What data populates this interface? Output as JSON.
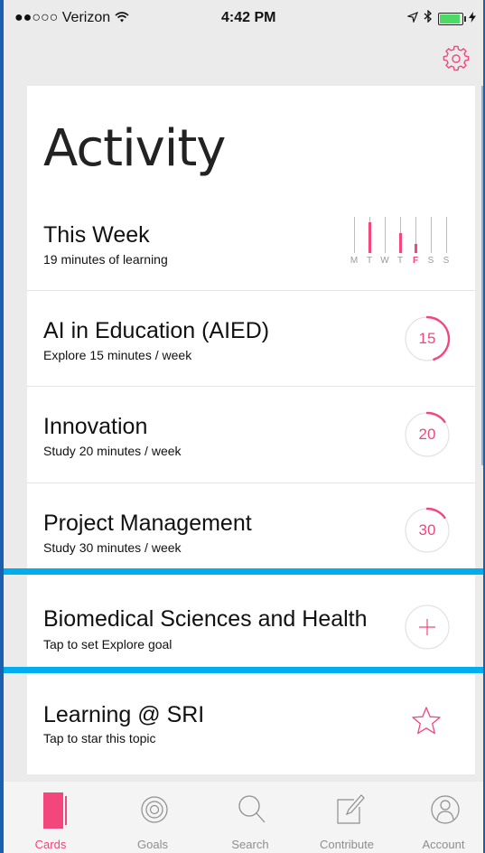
{
  "status_bar": {
    "carrier": "●●○○○ Verizon",
    "time": "4:42 PM"
  },
  "header": {
    "title": "Activity",
    "settings_icon": "gear-icon"
  },
  "this_week": {
    "title": "This Week",
    "subtitle": "19 minutes of learning",
    "days": [
      "M",
      "T",
      "W",
      "T",
      "F",
      "S",
      "S"
    ],
    "today_index": 4,
    "day_levels": [
      0,
      0.85,
      0,
      0.55,
      0.25,
      0,
      0
    ]
  },
  "topics": [
    {
      "title": "AI in Education (AIED)",
      "subtitle": "Explore 15 minutes / week",
      "goal": "15",
      "progress": 0.45
    },
    {
      "title": "Innovation",
      "subtitle": "Study 20 minutes / week",
      "goal": "20",
      "progress": 0.15
    },
    {
      "title": "Project Management",
      "subtitle": "Study 30 minutes / week",
      "goal": "30",
      "progress": 0.15
    },
    {
      "title": "Biomedical Sciences and Health",
      "subtitle": "Tap to set Explore goal",
      "action_icon": "plus-icon"
    },
    {
      "title": "Learning @ SRI",
      "subtitle": "Tap to star this topic",
      "action_icon": "star-icon"
    }
  ],
  "tabs": [
    {
      "label": "Cards",
      "icon": "cards-icon",
      "active": true
    },
    {
      "label": "Goals",
      "icon": "target-icon"
    },
    {
      "label": "Search",
      "icon": "search-icon"
    },
    {
      "label": "Contribute",
      "icon": "compose-icon"
    },
    {
      "label": "Account",
      "icon": "account-icon"
    }
  ],
  "colors": {
    "accent": "#f2467c",
    "highlight": "#00aeef"
  }
}
